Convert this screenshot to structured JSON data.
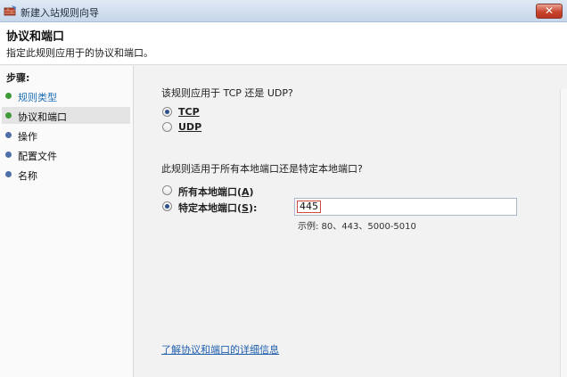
{
  "window": {
    "title": "新建入站规则向导",
    "close_glyph": "✕"
  },
  "header": {
    "title": "协议和端口",
    "description": "指定此规则应用于的协议和端口。"
  },
  "sidebar": {
    "steps_title": "步骤:",
    "items": [
      {
        "label": "规则类型",
        "state": "completed"
      },
      {
        "label": "协议和端口",
        "state": "current"
      },
      {
        "label": "操作",
        "state": "pending"
      },
      {
        "label": "配置文件",
        "state": "pending"
      },
      {
        "label": "名称",
        "state": "pending"
      }
    ]
  },
  "main": {
    "protocol_question": "该规则应用于 TCP 还是 UDP?",
    "tcp": {
      "label": "TCP",
      "checked": true
    },
    "udp": {
      "label": "UDP",
      "checked": false
    },
    "ports_question": "此规则适用于所有本地端口还是特定本地端口?",
    "all_ports": {
      "label": "所有本地端口",
      "key": "A",
      "checked": false
    },
    "specific_ports": {
      "label": "特定本地端口",
      "key": "S",
      "suffix": ":",
      "checked": true
    },
    "port_value": "445",
    "example": "示例: 80、443、5000-5010",
    "help_link": "了解协议和端口的详细信息"
  },
  "colors": {
    "completed_dot": "#3f9a3a",
    "pending_dot": "#4f6fa8",
    "link": "#1f5fae",
    "close_button": "#c9452e"
  },
  "icons": {
    "app": "firewall-wizard-icon",
    "close": "close-icon",
    "radio": "radio-button-icon"
  }
}
